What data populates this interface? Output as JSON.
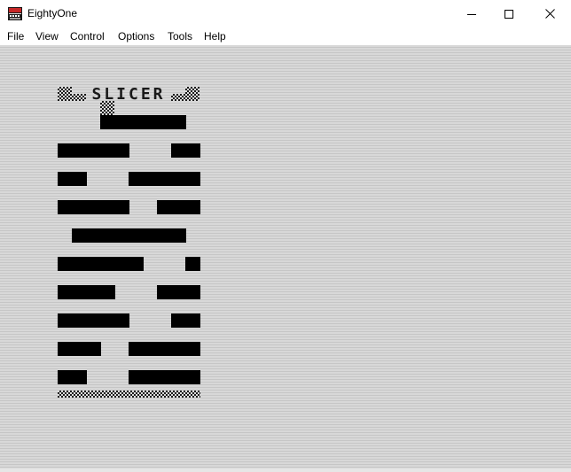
{
  "window": {
    "title": "EightyOne"
  },
  "menu": [
    {
      "id": "file",
      "label": "File"
    },
    {
      "id": "view",
      "label": "View"
    },
    {
      "id": "control",
      "label": "Control"
    },
    {
      "id": "options",
      "label": "Options"
    },
    {
      "id": "tools",
      "label": "Tools"
    },
    {
      "id": "help",
      "label": "Help"
    }
  ],
  "game": {
    "title_text": "SLICER",
    "colors": {
      "ink": "#000000",
      "paper": "#d7d7d7",
      "scanline": "#c6c6c6"
    }
  }
}
